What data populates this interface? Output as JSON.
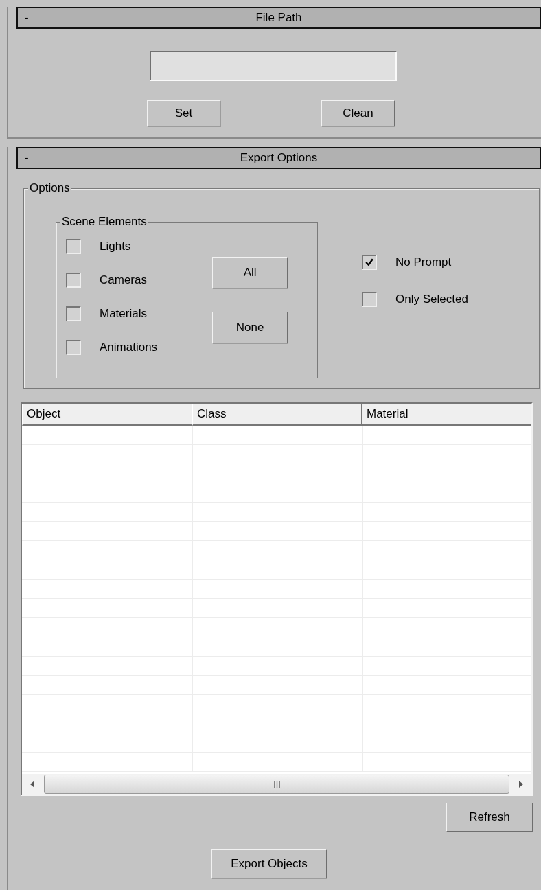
{
  "rollouts": [
    {
      "title": "File Path",
      "collapse_symbol": "-",
      "expanded": true
    },
    {
      "title": "Export Options",
      "collapse_symbol": "-",
      "expanded": true
    }
  ],
  "file_path": {
    "buttons": [
      "Set",
      "Clean"
    ]
  },
  "options": {
    "title": "Options",
    "scene_elements": {
      "title": "Scene Elements",
      "items": [
        {
          "label": "Lights",
          "checked": false
        },
        {
          "label": "Cameras",
          "checked": false
        },
        {
          "label": "Materials",
          "checked": false
        },
        {
          "label": "Animations",
          "checked": false
        }
      ],
      "buttons": [
        "All",
        "None"
      ]
    },
    "settings": [
      {
        "label": "No Prompt",
        "checked": true
      },
      {
        "label": "Only Selected",
        "checked": false
      }
    ]
  },
  "table": {
    "columns": [
      "Object",
      "Class",
      "Material"
    ]
  },
  "buttons": {
    "refresh": "Refresh",
    "export": "Export Objects"
  }
}
